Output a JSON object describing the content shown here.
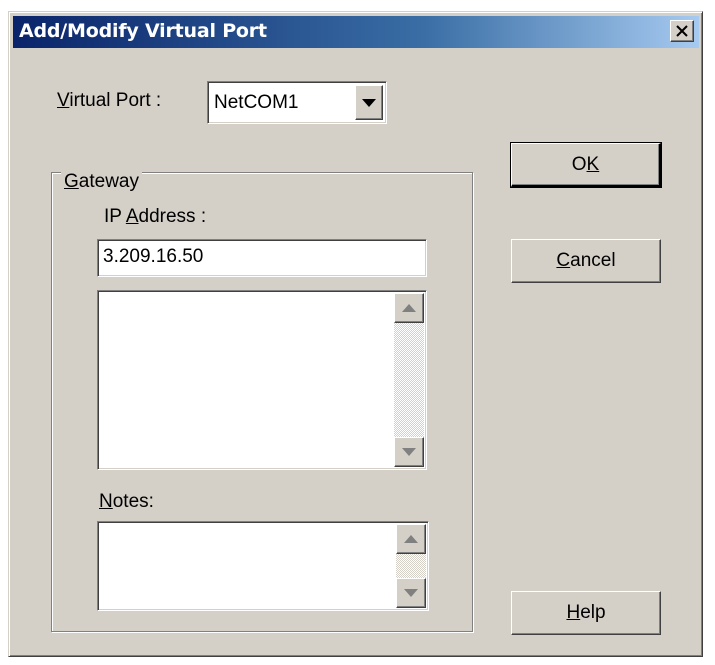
{
  "window": {
    "title": "Add/Modify Virtual Port",
    "close_glyph": "close-icon"
  },
  "virtual_port": {
    "label_prefix": "",
    "label_mnemonic": "V",
    "label_rest": "irtual Port :",
    "selected": "NetCOM1"
  },
  "gateway": {
    "legend_mnemonic": "G",
    "legend_rest": "ateway",
    "ip_label_prefix": "IP ",
    "ip_label_mnemonic": "A",
    "ip_label_rest": "ddress :",
    "ip_value": "3.209.16.50",
    "notes_label_mnemonic": "N",
    "notes_label_rest": "otes:"
  },
  "buttons": {
    "ok_prefix": "O",
    "ok_mnemonic": "K",
    "cancel_mnemonic": "C",
    "cancel_rest": "ancel",
    "help_mnemonic": "H",
    "help_rest": "elp"
  },
  "colors": {
    "face": "#d4d0c8",
    "title_start": "#0a246a",
    "title_end": "#a6caf0"
  }
}
